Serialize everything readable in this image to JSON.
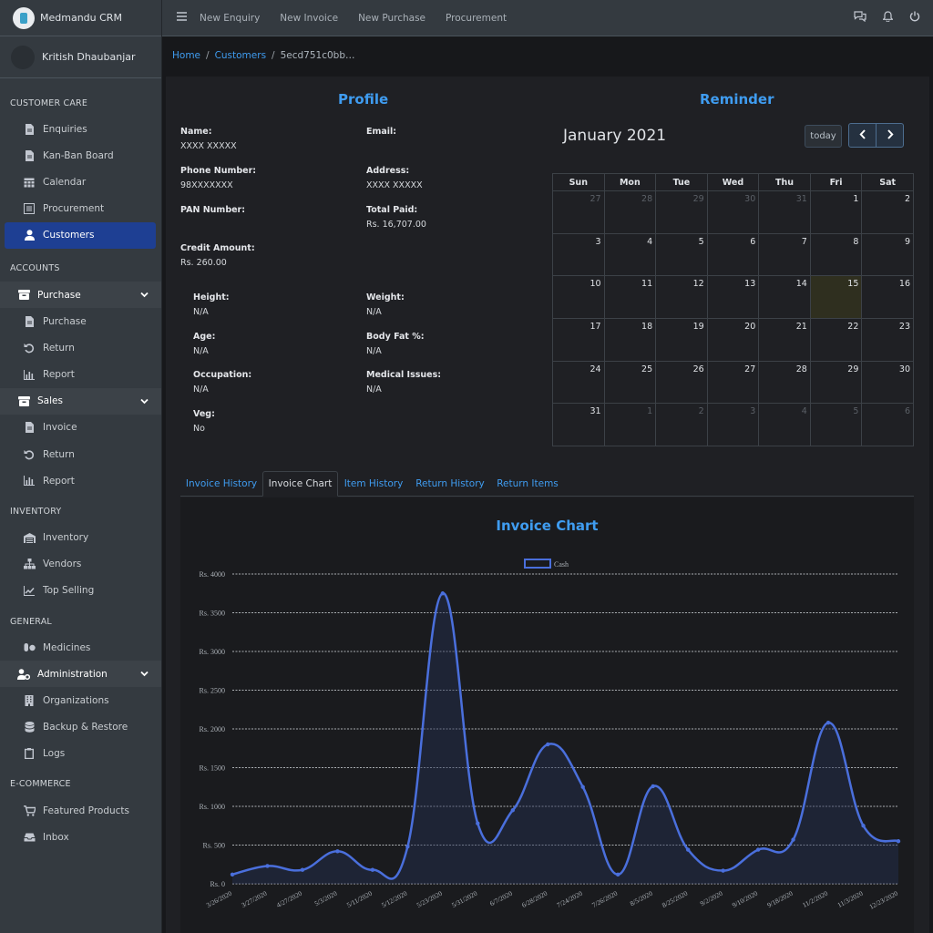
{
  "app": {
    "brand": "Medmandu CRM",
    "user": "Kritish Dhaubanjar"
  },
  "sidebar": {
    "customer_care": "CUSTOMER CARE",
    "enquiries": "Enquiries",
    "kanban": "Kan-Ban Board",
    "calendar": "Calendar",
    "procurement": "Procurement",
    "customers": "Customers",
    "accounts": "ACCOUNTS",
    "purchase_group": "Purchase",
    "purchase": "Purchase",
    "purchase_return": "Return",
    "purchase_report": "Report",
    "sales_group": "Sales",
    "invoice": "Invoice",
    "sales_return": "Return",
    "sales_report": "Report",
    "inventory_header": "INVENTORY",
    "inventory": "Inventory",
    "vendors": "Vendors",
    "top_selling": "Top Selling",
    "general": "GENERAL",
    "medicines": "Medicines",
    "administration": "Administration",
    "organizations": "Organizations",
    "backup": "Backup & Restore",
    "logs": "Logs",
    "ecommerce": "E-COMMERCE",
    "featured": "Featured Products",
    "inbox": "Inbox"
  },
  "topbar": {
    "new_enquiry": "New Enquiry",
    "new_invoice": "New Invoice",
    "new_purchase": "New Purchase",
    "procurement": "Procurement"
  },
  "breadcrumb": {
    "home": "Home",
    "customers": "Customers",
    "id": "5ecd751c0bb…"
  },
  "profile": {
    "title": "Profile",
    "name_k": "Name:",
    "name_v": "XXXX XXXXX",
    "email_k": "Email:",
    "phone_k": "Phone Number:",
    "phone_v": "98XXXXXXX",
    "address_k": "Address:",
    "address_v": "XXXX XXXXX",
    "pan_k": "PAN Number:",
    "total_k": "Total Paid:",
    "total_v": "Rs. 16,707.00",
    "credit_k": "Credit Amount:",
    "credit_v": "Rs. 260.00",
    "height_k": "Height:",
    "height_v": "N/A",
    "weight_k": "Weight:",
    "weight_v": "N/A",
    "age_k": "Age:",
    "age_v": "N/A",
    "bodyfat_k": "Body Fat %:",
    "bodyfat_v": "N/A",
    "occupation_k": "Occupation:",
    "occupation_v": "N/A",
    "medical_k": "Medical Issues:",
    "medical_v": "N/A",
    "veg_k": "Veg:",
    "veg_v": "No"
  },
  "reminder": {
    "title": "Reminder",
    "month": "January 2021",
    "today": "today",
    "days": [
      "Sun",
      "Mon",
      "Tue",
      "Wed",
      "Thu",
      "Fri",
      "Sat"
    ],
    "weeks": [
      [
        "27",
        "28",
        "29",
        "30",
        "31",
        "1",
        "2"
      ],
      [
        "3",
        "4",
        "5",
        "6",
        "7",
        "8",
        "9"
      ],
      [
        "10",
        "11",
        "12",
        "13",
        "14",
        "15",
        "16"
      ],
      [
        "17",
        "18",
        "19",
        "20",
        "21",
        "22",
        "23"
      ],
      [
        "24",
        "25",
        "26",
        "27",
        "28",
        "29",
        "30"
      ],
      [
        "31",
        "1",
        "2",
        "3",
        "4",
        "5",
        "6"
      ]
    ]
  },
  "tabs": [
    "Invoice History",
    "Invoice Chart",
    "Item History",
    "Return History",
    "Return Items"
  ],
  "colors": {
    "accent": "#3f9cf0",
    "series": "#4a6fdc"
  },
  "chart_data": {
    "type": "line",
    "title": "Invoice Chart",
    "x": [
      "3/26/2020",
      "3/27/2020",
      "4/27/2020",
      "5/3/2020",
      "5/11/2020",
      "5/12/2020",
      "5/23/2020",
      "5/31/2020",
      "6/7/2020",
      "6/28/2020",
      "7/24/2020",
      "7/26/2020",
      "8/5/2020",
      "8/25/2020",
      "9/2/2020",
      "9/10/2020",
      "9/18/2020",
      "11/2/2020",
      "11/3/2020",
      "12/23/2020"
    ],
    "series": [
      {
        "name": "Cash",
        "values": [
          120,
          230,
          180,
          420,
          180,
          480,
          3750,
          780,
          950,
          1800,
          1250,
          120,
          1260,
          440,
          170,
          440,
          570,
          2080,
          750,
          550
        ]
      }
    ],
    "ylim": [
      0,
      4000
    ],
    "yticks": [
      "Rs. 0",
      "Rs. 500",
      "Rs. 1000",
      "Rs. 1500",
      "Rs. 2000",
      "Rs. 2500",
      "Rs. 3000",
      "Rs. 3500",
      "Rs. 4000"
    ],
    "grid": true,
    "legend": "top"
  }
}
